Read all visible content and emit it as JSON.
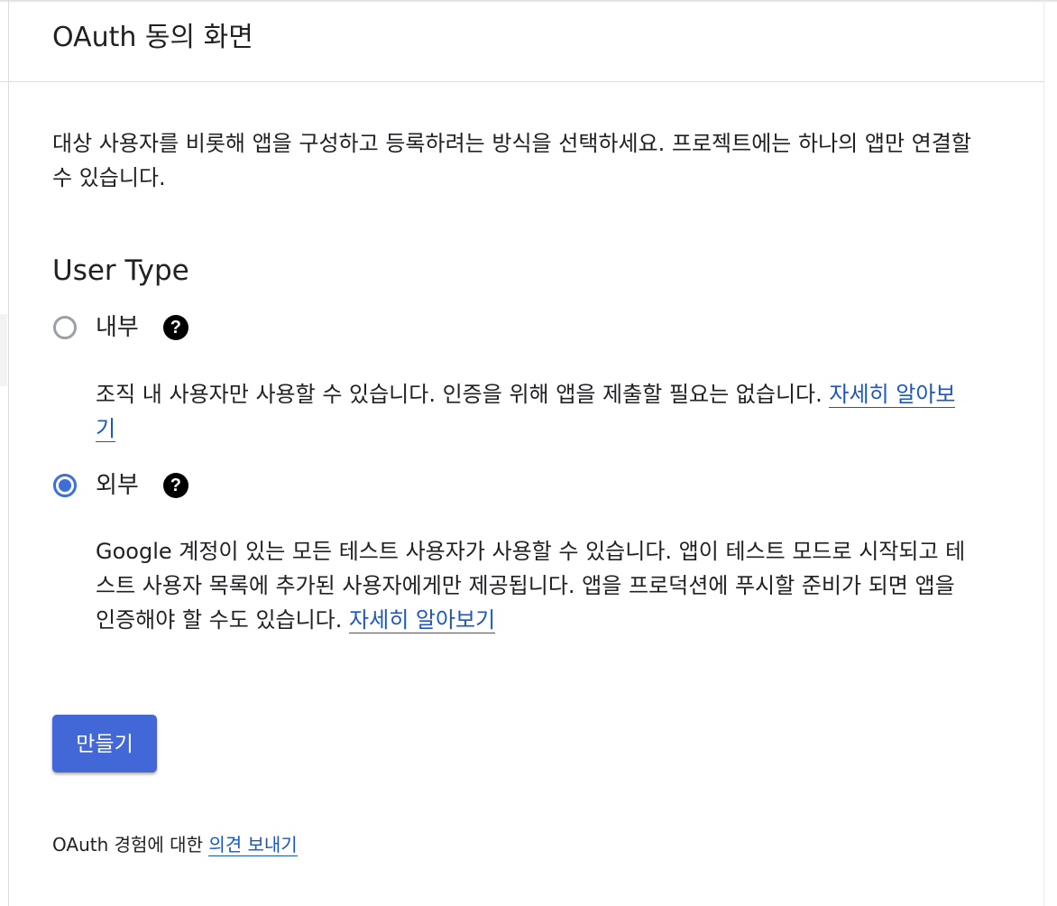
{
  "header": {
    "title": "OAuth 동의 화면"
  },
  "intro": {
    "text": "대상 사용자를 비롯해 앱을 구성하고 등록하려는 방식을 선택하세요. 프로젝트에는 하나의 앱만 연결할 수 있습니다."
  },
  "user_type": {
    "title": "User Type",
    "help_icon": "help-circle-icon",
    "options": [
      {
        "label": "내부",
        "checked": false,
        "description": "조직 내 사용자만 사용할 수 있습니다. 인증을 위해 앱을 제출할 필요는 없습니다. ",
        "link": "자세히 알아보기"
      },
      {
        "label": "외부",
        "checked": true,
        "description": "Google 계정이 있는 모든 테스트 사용자가 사용할 수 있습니다. 앱이 테스트 모드로 시작되고 테스트 사용자 목록에 추가된 사용자에게만 제공됩니다. 앱을 프로덕션에 푸시할 준비가 되면 앱을 인증해야 할 수도 있습니다. ",
        "link": "자세히 알아보기"
      }
    ]
  },
  "actions": {
    "create_label": "만들기"
  },
  "feedback": {
    "text": "OAuth 경험에 대한 ",
    "link": "의견 보내기"
  },
  "colors": {
    "accent": "#4267d6",
    "link": "#1a56c4",
    "radio_unchecked": "#9aa0a6",
    "text": "#202124"
  }
}
